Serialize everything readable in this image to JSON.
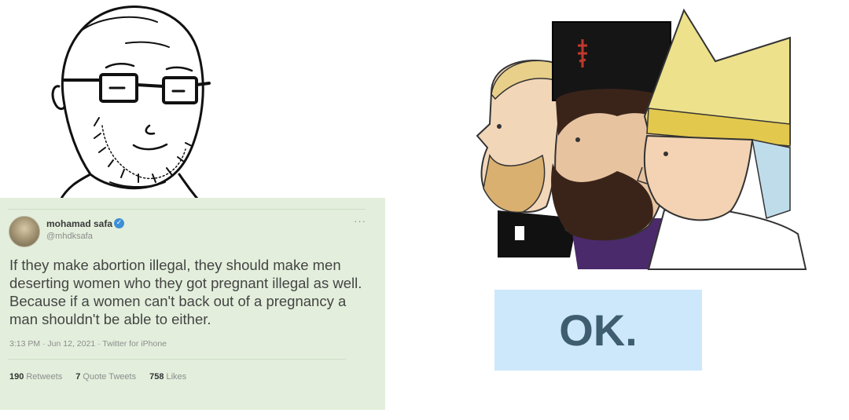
{
  "tweet": {
    "author_name": "mohamad safa",
    "author_handle": "@mhdksafa",
    "text": "If they make abortion illegal, they should make men deserting women who they got pregnant illegal as well. Because if a women can't back out of a pregnancy a man shouldn't be able to either.",
    "body_lines": [
      "If they make abortion illegal, they should make men",
      "deserting women who they got pregnant illegal as well.",
      "Because if a women can't back out of a pregnancy a",
      "man shouldn't be able to either."
    ],
    "timestamp": "3:13 PM · Jun 12, 2021 · Twitter for iPhone",
    "more_glyph": "···",
    "verified_glyph": "✓",
    "stats": {
      "retweets_count": "190",
      "retweets_label": "Retweets",
      "quote_count": "7",
      "quote_label": "Quote Tweets",
      "likes_count": "758",
      "likes_label": "Likes"
    }
  },
  "reply": {
    "text": "OK.",
    "background": "#cde8fb",
    "text_color": "#3f5d70"
  },
  "colors": {
    "tweet_background": "#e3efdc",
    "verified_blue": "#3d8fd6"
  },
  "icons": {
    "wojak": "wojak-glasses-drawing",
    "chads": "three-bearded-clergymen-drawing",
    "avatar": "user-avatar",
    "verified": "verified-badge-icon",
    "more": "more-options-icon"
  }
}
